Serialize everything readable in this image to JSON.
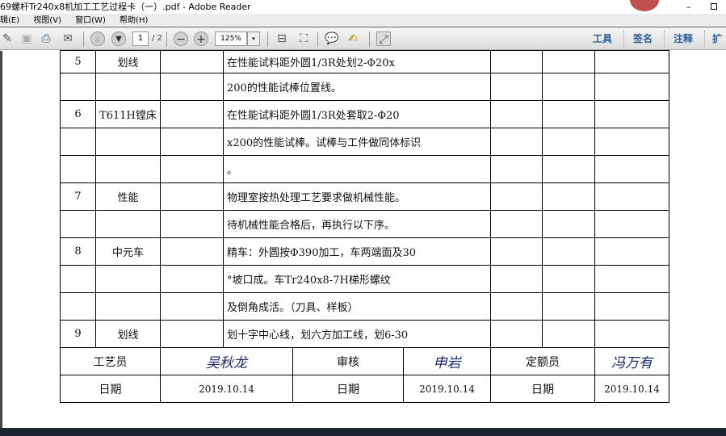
{
  "window": {
    "title": "69螺杆Tr240x8机加工工艺过程卡（一）.pdf - Adobe Reader",
    "minimize": "–"
  },
  "menu": [
    "辑(E)",
    "视图(V)",
    "窗口(W)",
    "帮助(H)"
  ],
  "toolbar": {
    "page": "1",
    "page_total": "/ 2",
    "zoom": "125%",
    "zoom_arrow": "▾",
    "right_links": [
      "工具",
      "签名",
      "注释",
      "扩"
    ]
  },
  "rows": [
    {
      "no": "5",
      "op": "划线",
      "desc": "在性能试料距外圆1/3R处划2-Φ20x"
    },
    {
      "no": "",
      "op": "",
      "desc": "200的性能试棒位置线。"
    },
    {
      "no": "6",
      "op": "T611H镗床",
      "desc": "在性能试料距外圆1/3R处套取2-Φ20"
    },
    {
      "no": "",
      "op": "",
      "desc": "x200的性能试棒。试棒与工件做同体标识"
    },
    {
      "no": "",
      "op": "",
      "desc": "。"
    },
    {
      "no": "7",
      "op": "性能",
      "desc": "物理室按热处理工艺要求做机械性能。"
    },
    {
      "no": "",
      "op": "",
      "desc": "待机械性能合格后，再执行以下序。"
    },
    {
      "no": "8",
      "op": "中元车",
      "desc": "精车：外圆按Φ390加工，车两端面及30"
    },
    {
      "no": "",
      "op": "",
      "desc": "°坡口成。车Tr240x8-7H梯形螺纹"
    },
    {
      "no": "",
      "op": "",
      "desc": "及倒角成活。（刀具、样板）"
    },
    {
      "no": "9",
      "op": "划线",
      "desc": "划十字中心线，划六方加工线，划6-30"
    }
  ],
  "signoff": {
    "labels": [
      "工艺员",
      "审核",
      "定额员"
    ],
    "signatures": [
      "吴秋龙",
      "申岩",
      "冯万有"
    ],
    "date_label": "日期",
    "dates": [
      "2019.10.14",
      "2019.10.14",
      "2019.10.14"
    ]
  }
}
